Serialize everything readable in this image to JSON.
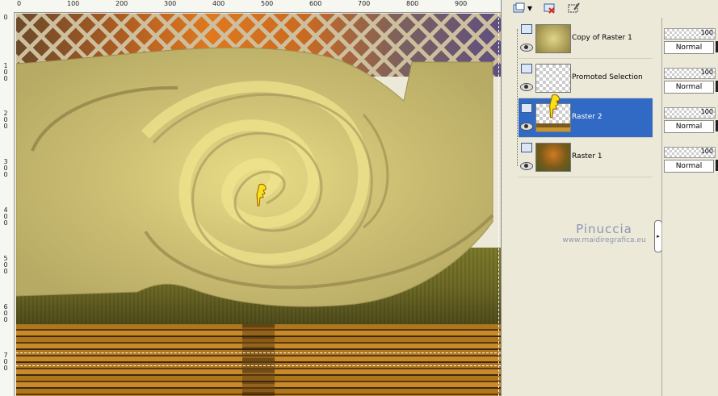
{
  "ruler": {
    "top_labels": [
      "0",
      "100",
      "200",
      "300",
      "400",
      "500",
      "600",
      "700",
      "800",
      "900"
    ],
    "left_labels": [
      "0",
      "1 0 0",
      "2 0 0",
      "3 0 0",
      "4 0 0",
      "5 0 0",
      "6 0 0",
      "7 0 0"
    ]
  },
  "layers": {
    "toolbar_icons": [
      "new-layer-icon",
      "dropdown-arrow-icon",
      "delete-layer-icon",
      "selection-icon"
    ],
    "items": [
      {
        "name": "Copy of Raster 1",
        "selected": false
      },
      {
        "name": "Promoted Selection",
        "selected": false
      },
      {
        "name": "Raster 2",
        "selected": true
      },
      {
        "name": "Raster 1",
        "selected": false
      }
    ]
  },
  "properties": [
    {
      "opacity": "100",
      "blend": "Normal"
    },
    {
      "opacity": "100",
      "blend": "Normal"
    },
    {
      "opacity": "100",
      "blend": "Normal"
    },
    {
      "opacity": "100",
      "blend": "Normal"
    }
  ],
  "watermark": {
    "name": "Pinuccia",
    "url": "www.maidiregrafica.eu"
  },
  "colors": {
    "selected_row": "#316ac5",
    "panel_bg": "#ece9d8",
    "swirl_gold": "#d8cc7a"
  }
}
